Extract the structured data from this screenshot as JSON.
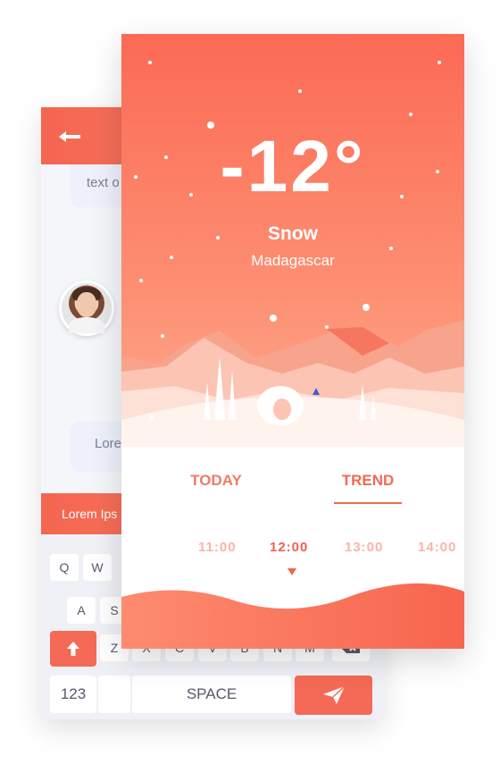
{
  "chat": {
    "messages": [
      {
        "text": "text o"
      },
      {
        "text": "Lore"
      }
    ],
    "reply_text": "Lorem Ips",
    "keyboard": {
      "row1": [
        "Q",
        "W"
      ],
      "row2": [
        "A",
        "S"
      ],
      "row3": [
        "Z",
        "X",
        "C",
        "V",
        "B",
        "N",
        "M"
      ],
      "numbers_label": "123",
      "space_label": "SPACE"
    }
  },
  "weather": {
    "temperature": "-12°",
    "condition": "Snow",
    "location": "Madagascar",
    "tabs": [
      {
        "label": "TODAY",
        "active": false
      },
      {
        "label": "TREND",
        "active": true
      }
    ],
    "times": [
      {
        "label": "11:00",
        "active": false
      },
      {
        "label": "12:00",
        "active": true
      },
      {
        "label": "13:00",
        "active": false
      },
      {
        "label": "14:00",
        "active": false
      }
    ]
  },
  "colors": {
    "accent": "#f56550",
    "accent_light": "#fd8f72",
    "muted_time": "#f9b5a7"
  },
  "icons": {
    "back": "back-arrow-icon",
    "shift": "arrow-up-icon",
    "delete": "backspace-icon",
    "send": "paper-plane-icon"
  }
}
